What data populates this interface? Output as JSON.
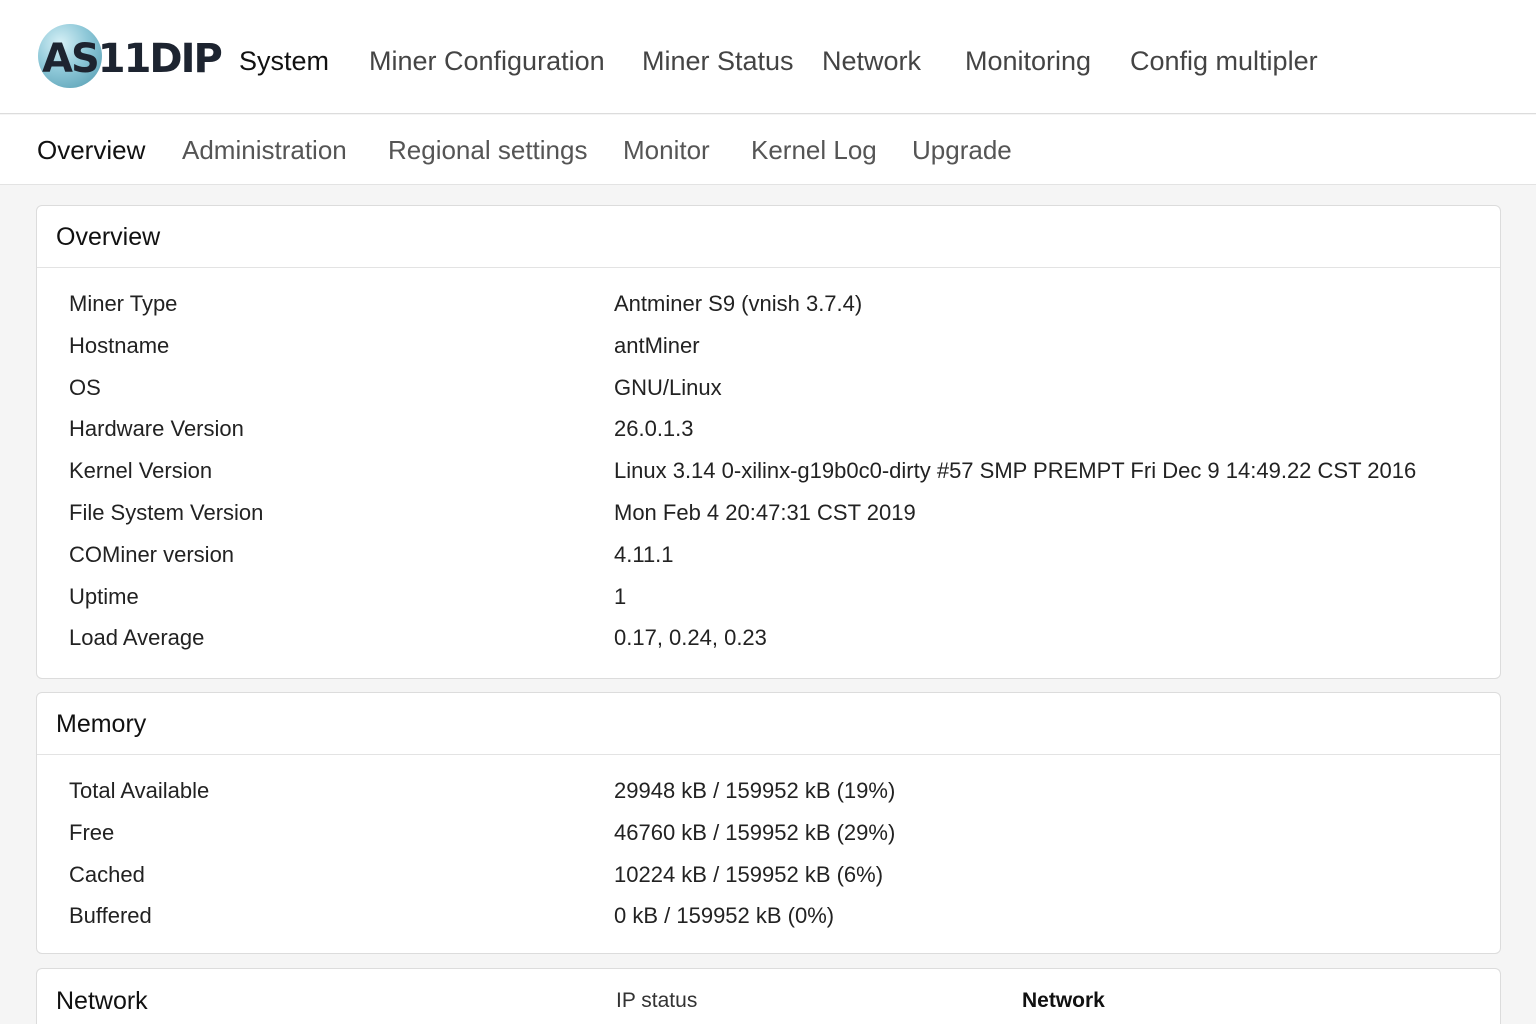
{
  "brand": {
    "logo_text": "AS11DIP"
  },
  "main_nav": [
    {
      "label": "System",
      "active": true
    },
    {
      "label": "Miner Configuration"
    },
    {
      "label": "Miner Status"
    },
    {
      "label": "Network"
    },
    {
      "label": "Monitoring"
    },
    {
      "label": "Config multipler"
    }
  ],
  "sub_nav": [
    {
      "label": "Overview",
      "active": true
    },
    {
      "label": "Administration"
    },
    {
      "label": "Regional settings"
    },
    {
      "label": "Monitor"
    },
    {
      "label": "Kernel Log"
    },
    {
      "label": "Upgrade"
    }
  ],
  "overview": {
    "title": "Overview",
    "rows": [
      {
        "label": "Miner Type",
        "value": "Antminer S9 (vnish 3.7.4)"
      },
      {
        "label": "Hostname",
        "value": "antMiner"
      },
      {
        "label": "OS",
        "value": "GNU/Linux"
      },
      {
        "label": "Hardware Version",
        "value": "26.0.1.3"
      },
      {
        "label": "Kernel Version",
        "value": "Linux 3.14 0-xilinx-g19b0c0-dirty #57 SMP PREMPT Fri Dec 9 14:49.22 CST 2016"
      },
      {
        "label": "File System Version",
        "value": "Mon Feb 4 20:47:31 CST 2019"
      },
      {
        "label": "COMiner version",
        "value": "4.11.1"
      },
      {
        "label": "Uptime",
        "value": "1"
      },
      {
        "label": "Load Average",
        "value": "0.17, 0.24, 0.23"
      }
    ]
  },
  "memory": {
    "title": "Memory",
    "rows": [
      {
        "label": "Total Available",
        "value": "29948 kB / 159952 kB (19%)"
      },
      {
        "label": "Free",
        "value": "46760 kB / 159952 kB (29%)"
      },
      {
        "label": "Cached",
        "value": "10224 kB / 159952 kB (6%)"
      },
      {
        "label": "Buffered",
        "value": "0 kB / 159952 kB (0%)"
      }
    ]
  },
  "network": {
    "title": "Network",
    "col_ip_status": "IP status",
    "col_network": "Network"
  }
}
